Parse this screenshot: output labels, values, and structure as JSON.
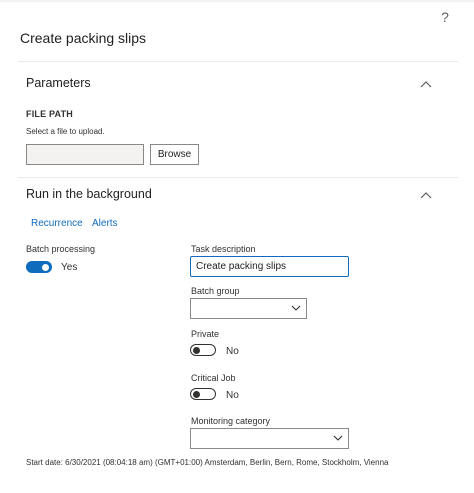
{
  "dialog": {
    "title": "Create packing slips",
    "help_symbol": "?"
  },
  "parameters": {
    "title": "Parameters",
    "file_path_label": "FILE PATH",
    "file_path_caption": "Select a file to upload.",
    "file_path_value": "",
    "browse_label": "Browse"
  },
  "background": {
    "title": "Run in the background",
    "links": [
      "Recurrence",
      "Alerts"
    ],
    "batch_processing": {
      "label": "Batch processing",
      "state": "Yes",
      "on": true
    },
    "task_description": {
      "label": "Task description",
      "value": "Create packing slips"
    },
    "batch_group": {
      "label": "Batch group",
      "value": ""
    },
    "private": {
      "label": "Private",
      "state": "No",
      "on": false
    },
    "critical_job": {
      "label": "Critical Job",
      "state": "No",
      "on": false
    },
    "monitoring_category": {
      "label": "Monitoring category",
      "value": ""
    },
    "start_date": "Start date: 6/30/2021 (08:04:18 am) (GMT+01:00) Amsterdam, Berlin, Bern, Rome, Stockholm, Vienna"
  },
  "colors": {
    "accent": "#0f6cbd",
    "text": "#323130",
    "border": "#8a8886"
  },
  "icons": {
    "help": "help-icon",
    "collapse": "chevron-up-icon",
    "dropdown": "chevron-down-icon"
  }
}
